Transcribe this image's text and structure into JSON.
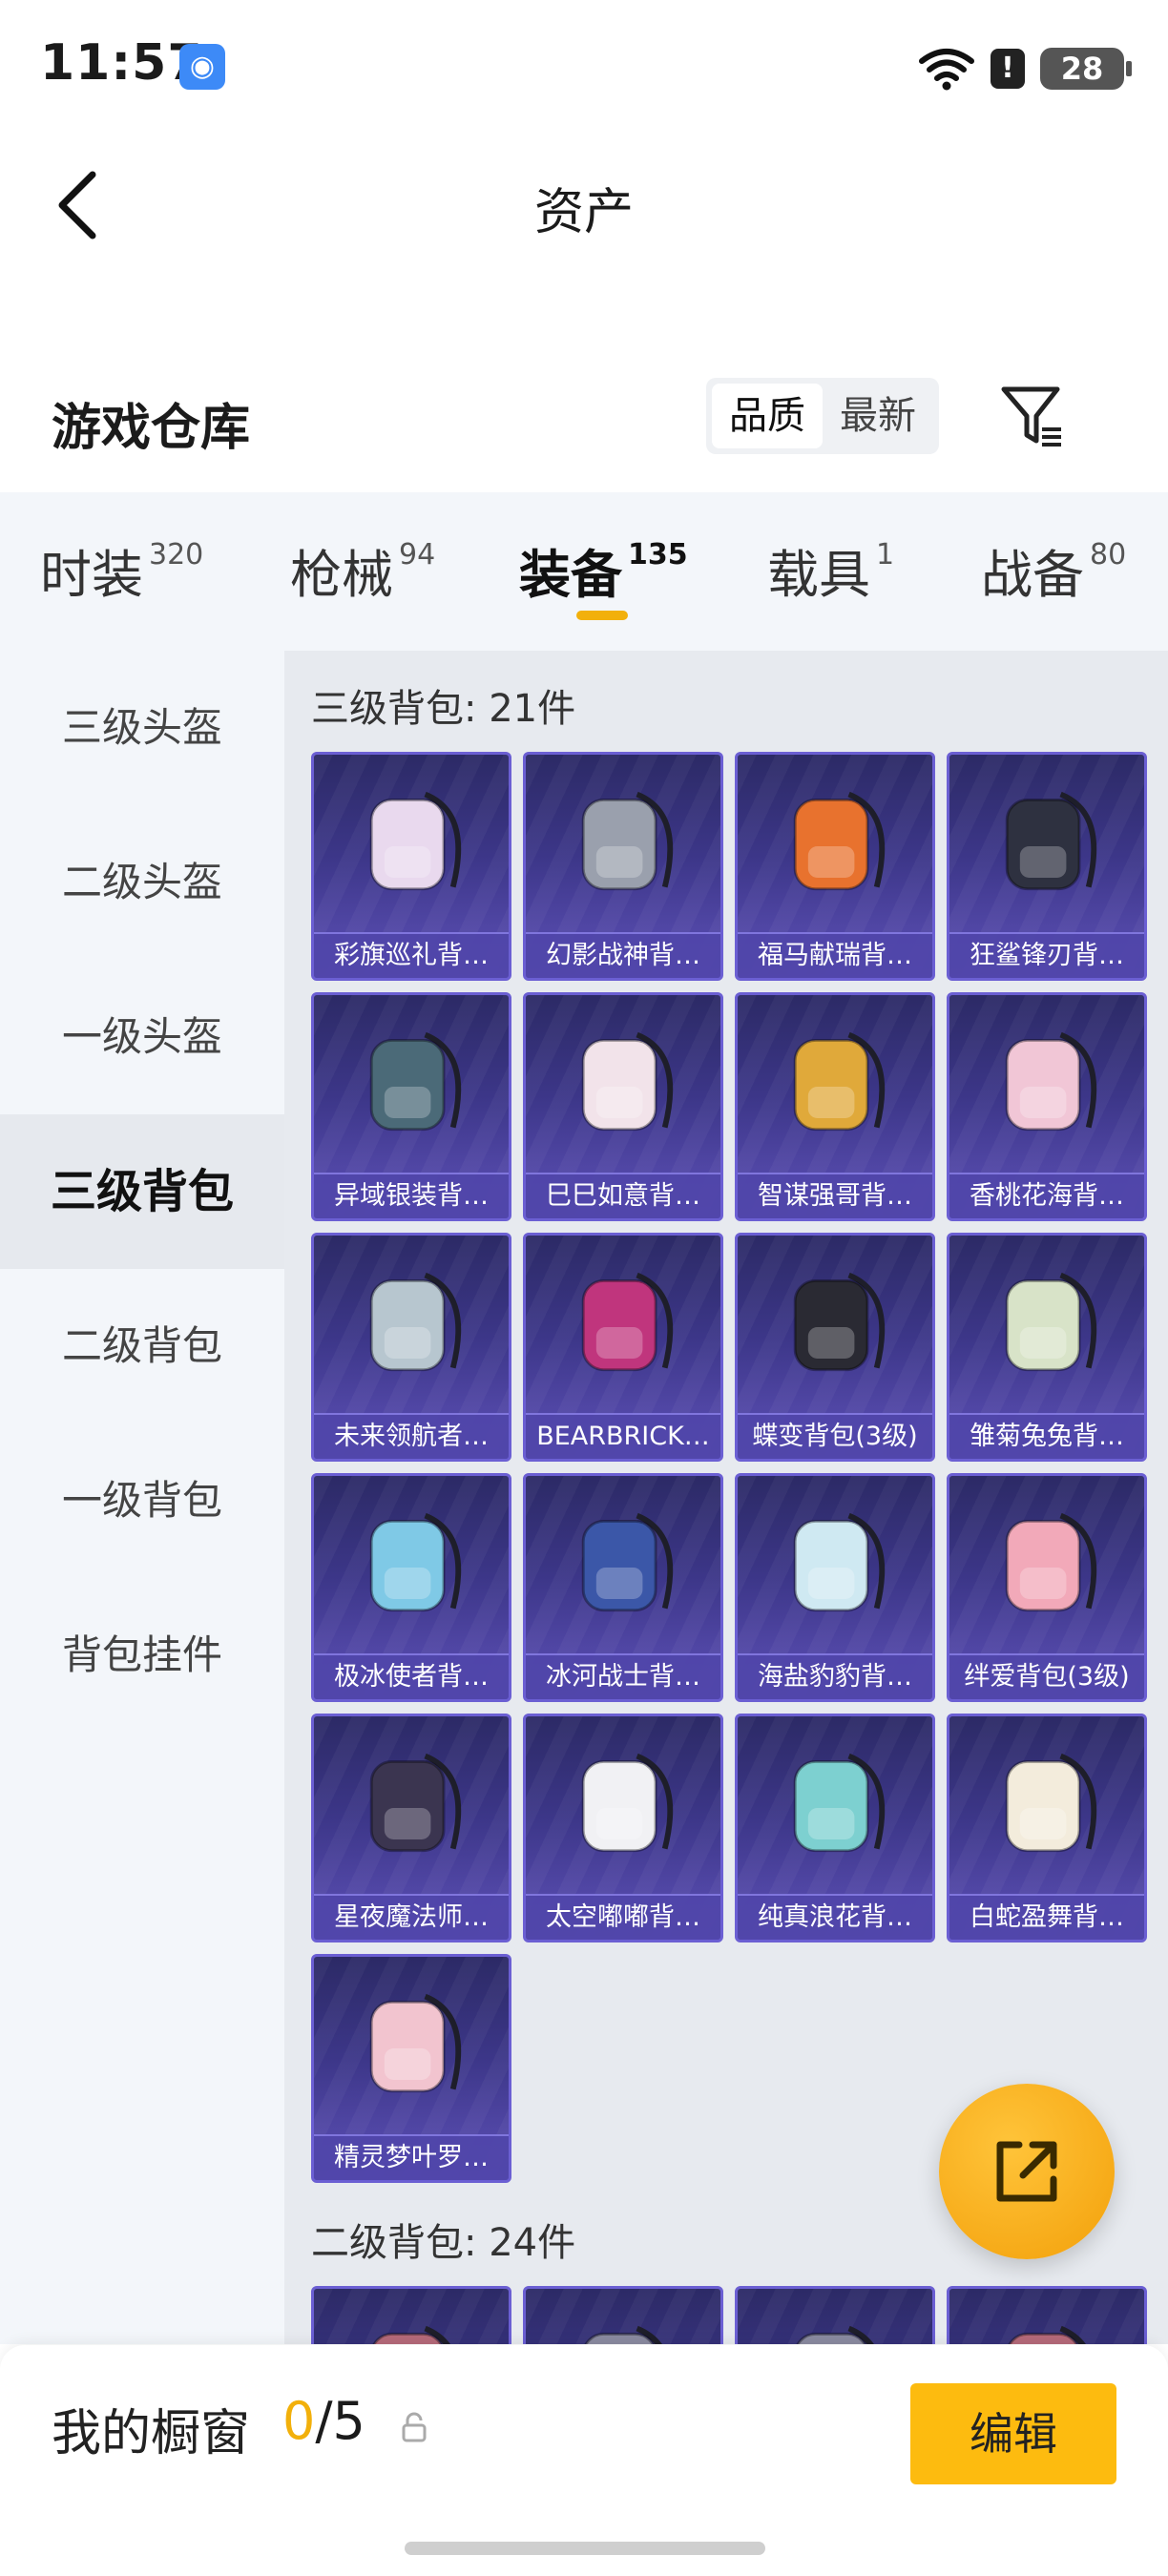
{
  "status_bar": {
    "time": "11:57",
    "battery": "28"
  },
  "header": {
    "title": "资产",
    "back_icon": "chevron-left-icon"
  },
  "warehouse": {
    "title": "游戏仓库",
    "sort_options": [
      "品质",
      "最新"
    ],
    "sort_selected": "品质",
    "filter_icon": "filter-icon"
  },
  "tabs": [
    {
      "label": "时装",
      "count": "320"
    },
    {
      "label": "枪械",
      "count": "94"
    },
    {
      "label": "装备",
      "count": "135",
      "active": true
    },
    {
      "label": "载具",
      "count": "1"
    },
    {
      "label": "战备",
      "count": "80"
    }
  ],
  "sidebar": [
    {
      "label": "三级头盔"
    },
    {
      "label": "二级头盔"
    },
    {
      "label": "一级头盔"
    },
    {
      "label": "三级背包",
      "active": true
    },
    {
      "label": "二级背包"
    },
    {
      "label": "一级背包"
    },
    {
      "label": "背包挂件"
    }
  ],
  "sections": [
    {
      "title": "三级背包: 21件",
      "items": [
        {
          "name": "彩旗巡礼背…",
          "color": "#e9d9ee"
        },
        {
          "name": "幻影战神背…",
          "color": "#9aa0ad"
        },
        {
          "name": "福马献瑞背…",
          "color": "#e8722e"
        },
        {
          "name": "狂鲨锋刃背…",
          "color": "#2e3140"
        },
        {
          "name": "异域银装背…",
          "color": "#4b6a78"
        },
        {
          "name": "巳巳如意背…",
          "color": "#f2e3ea"
        },
        {
          "name": "智谋强哥背…",
          "color": "#e0a93a"
        },
        {
          "name": "香桃花海背…",
          "color": "#f1c6d6"
        },
        {
          "name": "未来领航者…",
          "color": "#b7c6cf"
        },
        {
          "name": "BEARBRICK…",
          "color": "#c0357d"
        },
        {
          "name": "蝶变背包(3级)",
          "color": "#2a2a33"
        },
        {
          "name": "雏菊兔兔背…",
          "color": "#d8e3c8"
        },
        {
          "name": "极冰使者背…",
          "color": "#7fc9e6"
        },
        {
          "name": "冰河战士背…",
          "color": "#3b57a8"
        },
        {
          "name": "海盐豹豹背…",
          "color": "#cfe9f2"
        },
        {
          "name": "绊爱背包(3级)",
          "color": "#f2a9b9"
        },
        {
          "name": "星夜魔法师…",
          "color": "#3b3550"
        },
        {
          "name": "太空嘟嘟背…",
          "color": "#f1f1f4"
        },
        {
          "name": "纯真浪花背…",
          "color": "#7dd0d0"
        },
        {
          "name": "白蛇盈舞背…",
          "color": "#f3ecdc"
        },
        {
          "name": "精灵梦叶罗…",
          "color": "#f2c4cf"
        }
      ]
    },
    {
      "title": "二级背包: 24件",
      "items": [
        {
          "name": "",
          "color": "#b56a7a"
        },
        {
          "name": "",
          "color": "#8a8aa0"
        },
        {
          "name": "",
          "color": "#8a8aa0"
        },
        {
          "name": "",
          "color": "#b56a7a"
        }
      ]
    }
  ],
  "fab": {
    "icon": "share-external-icon"
  },
  "showcase": {
    "label": "我的橱窗",
    "current": "0",
    "total": "/5",
    "lock_icon": "lock-icon"
  },
  "edit_button": "编辑"
}
